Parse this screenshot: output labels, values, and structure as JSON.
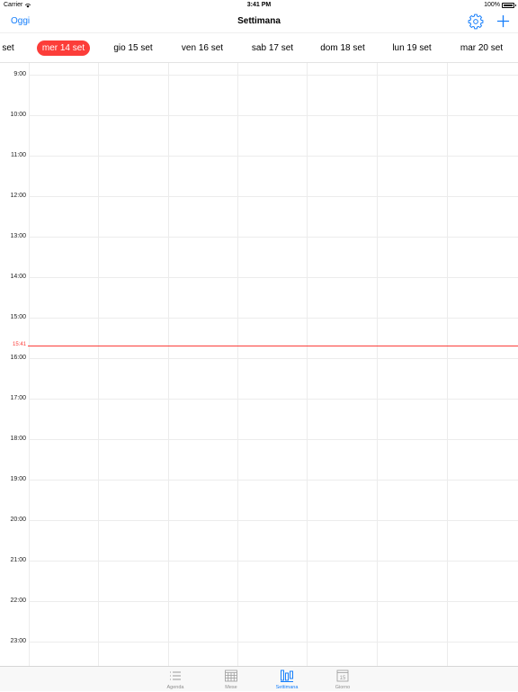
{
  "status_bar": {
    "carrier": "Carrier",
    "time": "3:41 PM",
    "battery": "100%"
  },
  "nav": {
    "today_label": "Oggi",
    "title": "Settimana",
    "settings_icon": "gear-icon",
    "add_icon": "plus-icon"
  },
  "days": [
    "set",
    "mer 14 set",
    "gio 15 set",
    "ven 16 set",
    "sab 17 set",
    "dom 18 set",
    "lun 19 set",
    "mar 20 set"
  ],
  "selected_day": "mer 14 set",
  "hours": [
    "9:00",
    "10:00",
    "11:00",
    "12:00",
    "13:00",
    "14:00",
    "15:00",
    "16:00",
    "17:00",
    "18:00",
    "19:00",
    "20:00",
    "21:00",
    "22:00",
    "23:00"
  ],
  "current_time": "15:41",
  "tabs": [
    {
      "label": "Agenda",
      "icon": "list-icon",
      "active": false
    },
    {
      "label": "Mese",
      "icon": "month-grid-icon",
      "active": false
    },
    {
      "label": "Settimana",
      "icon": "week-columns-icon",
      "active": true
    },
    {
      "label": "Giorno",
      "icon": "day-calendar-icon",
      "active": false
    }
  ],
  "colors": {
    "accent": "#157efb",
    "today": "#fc3d39",
    "grid": "#ececec"
  }
}
